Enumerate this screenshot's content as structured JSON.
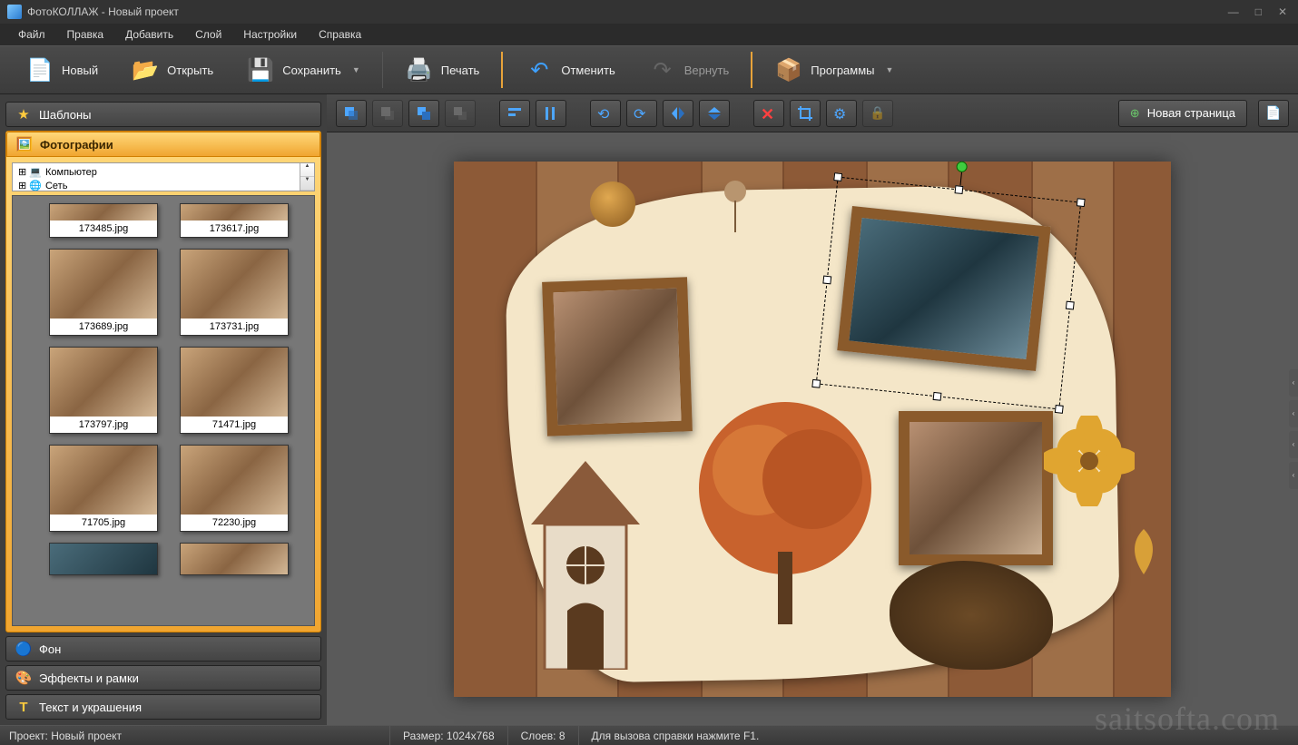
{
  "title": "ФотоКОЛЛАЖ - Новый проект",
  "menu": {
    "file": "Файл",
    "edit": "Правка",
    "add": "Добавить",
    "layer": "Слой",
    "settings": "Настройки",
    "help": "Справка"
  },
  "toolbar": {
    "new": "Новый",
    "open": "Открыть",
    "save": "Сохранить",
    "print": "Печать",
    "undo": "Отменить",
    "redo": "Вернуть",
    "programs": "Программы"
  },
  "sidebar": {
    "templates": "Шаблоны",
    "photos": "Фотографии",
    "background": "Фон",
    "effects": "Эффекты и рамки",
    "text": "Текст и украшения",
    "tree": {
      "computer": "Компьютер",
      "network": "Сеть"
    },
    "thumbs": [
      "173485.jpg",
      "173617.jpg",
      "173689.jpg",
      "173731.jpg",
      "173797.jpg",
      "71471.jpg",
      "71705.jpg",
      "72230.jpg"
    ]
  },
  "canvas": {
    "new_page": "Новая страница"
  },
  "status": {
    "project_label": "Проект:",
    "project_name": "Новый проект",
    "size_label": "Размер:",
    "size_value": "1024x768",
    "layers_label": "Слоев:",
    "layers_value": "8",
    "help_hint": "Для вызова справки нажмите F1."
  },
  "watermark": "saitsofta.com"
}
